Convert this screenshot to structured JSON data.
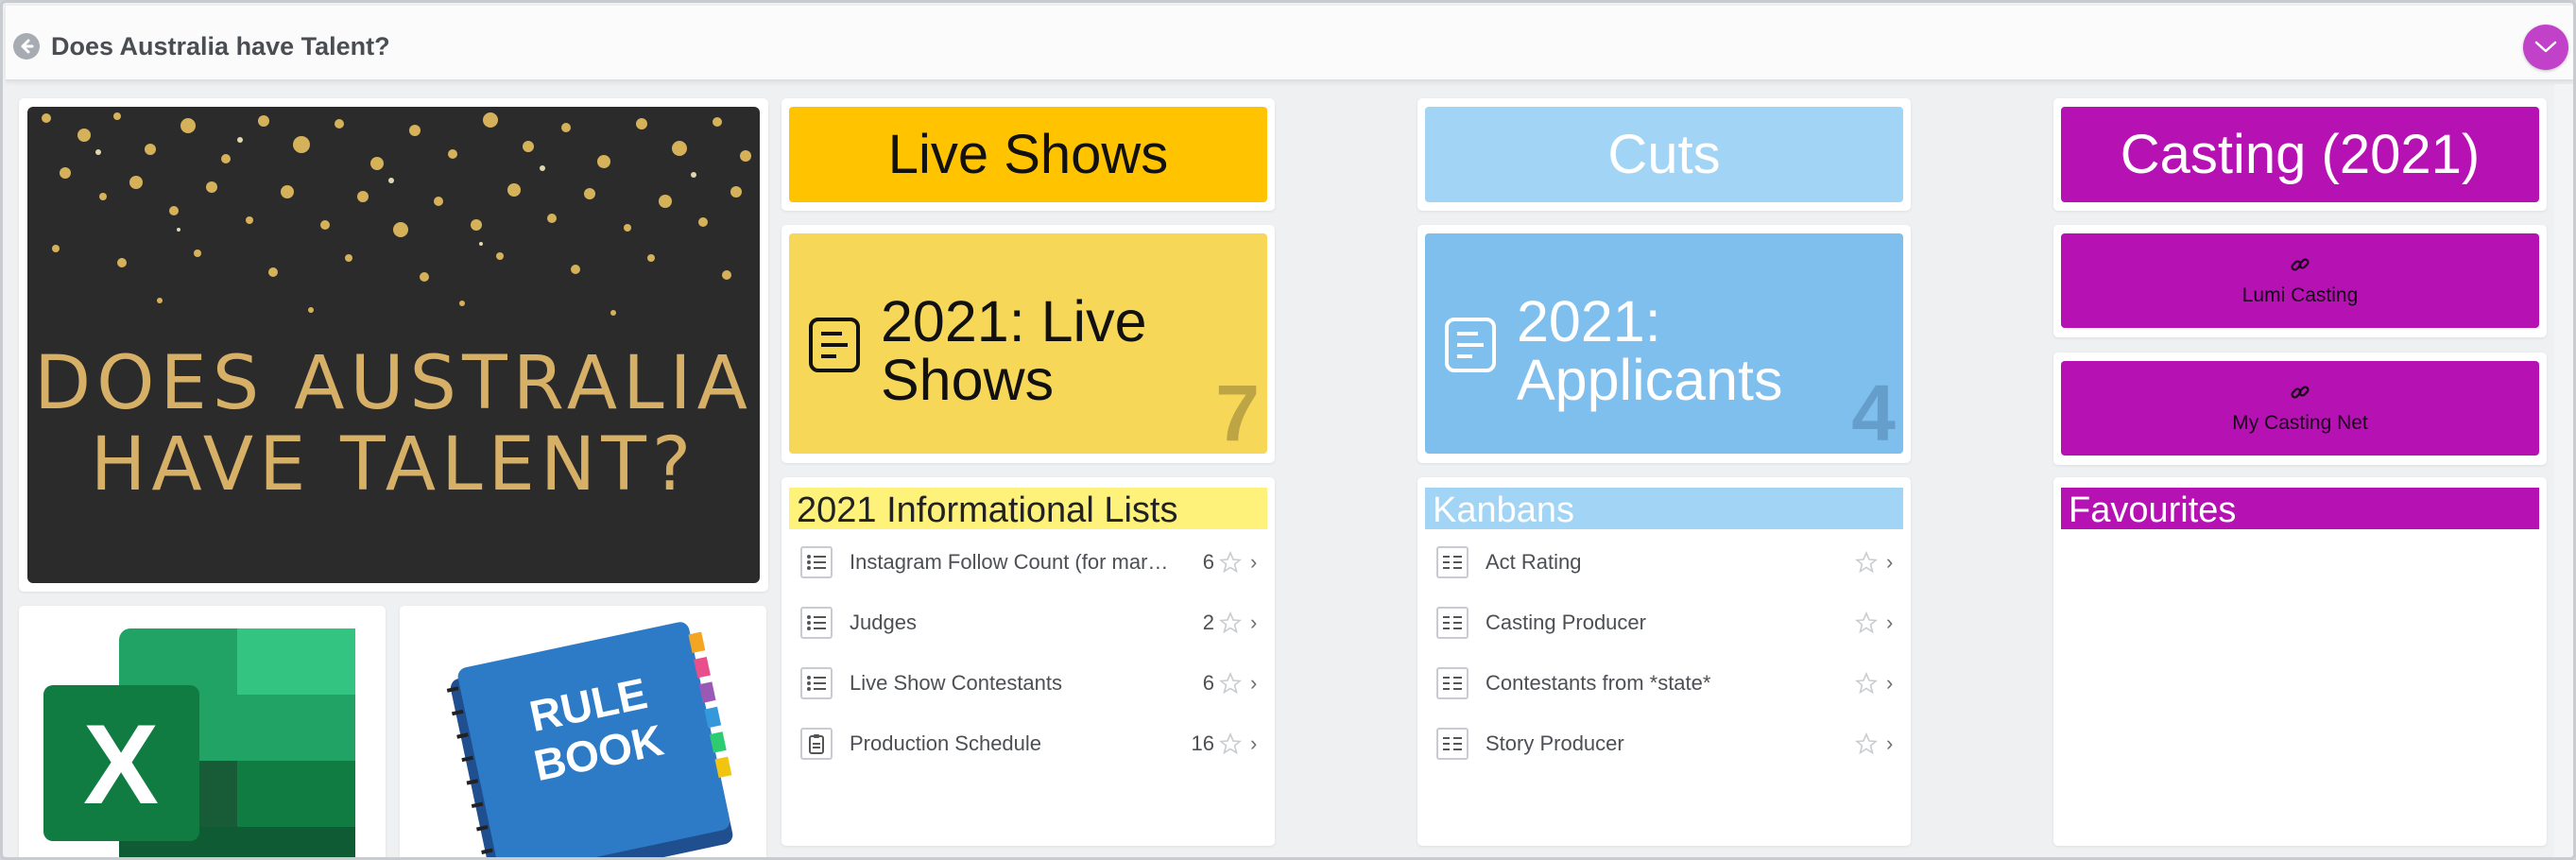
{
  "header": {
    "title": "Does Australia have Talent?",
    "back_icon": "arrow-left-icon",
    "menu_icon": "chevron-down-icon",
    "menu_color": "#c142c9"
  },
  "hero": {
    "lines": [
      "DOES AUSTRALIA",
      "HAVE TALENT?"
    ],
    "text_color": "#d7b068",
    "background": "#2b2b2b"
  },
  "thumbnails": [
    {
      "name": "excel-logo",
      "icon": "excel-icon"
    },
    {
      "name": "rule-book",
      "text_lines": [
        "RULE",
        "BOOK"
      ]
    }
  ],
  "columns": [
    {
      "header": {
        "label": "Live Shows",
        "color": "#ffc300",
        "text_color": "#111111"
      },
      "tile": {
        "label_lines": [
          "2021: Live",
          "Shows"
        ],
        "count": "7",
        "color": "#f7d758",
        "icon": "form-icon"
      },
      "section": {
        "label": "2021 Informational Lists",
        "color": "#fff27a",
        "text_color": "#222222"
      },
      "rows": [
        {
          "label": "Instagram Follow Count (for mar…",
          "count": "6",
          "icon": "list-icon"
        },
        {
          "label": "Judges",
          "count": "2",
          "icon": "list-icon"
        },
        {
          "label": "Live Show Contestants",
          "count": "6",
          "icon": "list-icon"
        },
        {
          "label": "Production Schedule",
          "count": "16",
          "icon": "clipboard-icon"
        }
      ]
    },
    {
      "header": {
        "label": "Cuts",
        "color": "#a1d4f5",
        "text_color": "#ffffff"
      },
      "tile": {
        "label_lines": [
          "2021:",
          "Applicants"
        ],
        "count": "4",
        "color": "#7fbfee",
        "icon": "form-icon"
      },
      "section": {
        "label": "Kanbans",
        "color": "#a1d4f5",
        "text_color": "#ffffff"
      },
      "rows": [
        {
          "label": "Act Rating",
          "count": "",
          "icon": "kanban-icon"
        },
        {
          "label": "Casting Producer",
          "count": "",
          "icon": "kanban-icon"
        },
        {
          "label": "Contestants from *state*",
          "count": "",
          "icon": "kanban-icon"
        },
        {
          "label": "Story Producer",
          "count": "",
          "icon": "kanban-icon"
        }
      ]
    },
    {
      "header": {
        "label": "Casting (2021)",
        "color": "#b611b3",
        "text_color": "#ffffff"
      },
      "links": [
        {
          "label": "Lumi Casting",
          "icon": "link-icon"
        },
        {
          "label": "My Casting Net",
          "icon": "link-icon"
        }
      ],
      "section": {
        "label": "Favourites",
        "color": "#b611b3",
        "text_color": "#ffffff"
      }
    }
  ]
}
